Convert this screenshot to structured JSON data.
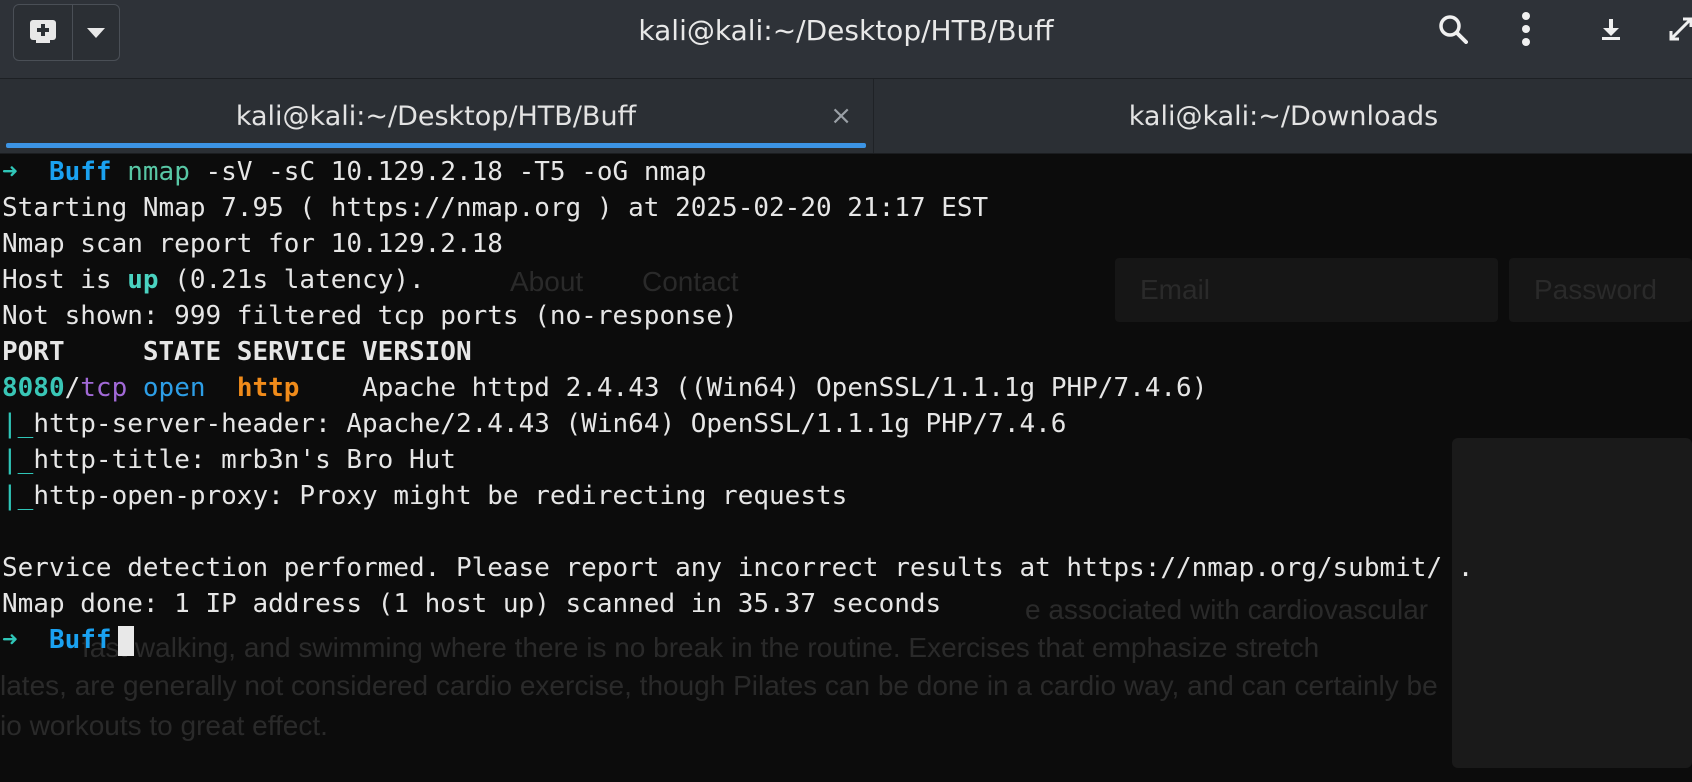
{
  "header": {
    "title": "kali@kali:~/Desktop/HTB/Buff",
    "icons": [
      "new-tab-icon",
      "chevron-down-icon",
      "search-icon",
      "kebab-menu-icon",
      "download-icon",
      "fullscreen-icon"
    ]
  },
  "tabs": [
    {
      "label": "kali@kali:~/Desktop/HTB/Buff",
      "active": true,
      "close": "×"
    },
    {
      "label": "kali@kali:~/Downloads",
      "active": false
    }
  ],
  "terminal": {
    "prompt_arrow": "➜",
    "prompt_dir": "Buff",
    "command_name": "nmap",
    "command_args": " -sV -sC 10.129.2.18 -T5 -oG nmap",
    "out1": "Starting Nmap 7.95 ( https://nmap.org ) at 2025-02-20 21:17 EST",
    "out2": "Nmap scan report for 10.129.2.18",
    "host_pre": "Host is ",
    "host_up": "up",
    "host_post": " (0.21s latency).",
    "out4": "Not shown: 999 filtered tcp ports (no-response)",
    "table_header": "PORT     STATE SERVICE VERSION",
    "port": "8080",
    "slash": "/",
    "proto": "tcp",
    "state": "open",
    "service": "http",
    "version": "    Apache httpd 2.4.43 ((Win64) OpenSSL/1.1.1g PHP/7.4.6)",
    "pipe": "|_",
    "script1": "http-server-header: Apache/2.4.43 (Win64) OpenSSL/1.1.1g PHP/7.4.6",
    "script2": "http-title: mrb3n's Bro Hut",
    "script3": "http-open-proxy: Proxy might be redirecting requests",
    "out_detect": "Service detection performed. Please report any incorrect results at https://nmap.org/submit/ .",
    "out_done": "Nmap done: 1 IP address (1 host up) scanned in 35.37 seconds"
  },
  "background_ghost": {
    "nav_about": "About",
    "nav_contact": "Contact",
    "email_placeholder": "Email",
    "password_placeholder": "Password",
    "para1": "e associated with cardiovascular",
    "para2": "fast walking, and swimming where there is no break in the routine. Exercises that emphasize stretch",
    "para3": "lates, are generally not considered cardio exercise, though Pilates can be done in a cardio way, and can certainly be",
    "para4": "io workouts to great effect."
  },
  "colors": {
    "header_bg": "#2e3238",
    "terminal_bg": "#0c0c0c",
    "tab_underline": "#3c94e4",
    "prompt_arrow": "#2fc6b8",
    "prompt_dir": "#1aa1f0",
    "service_http": "#f08b1a",
    "proto_tcp": "#a169d6"
  }
}
